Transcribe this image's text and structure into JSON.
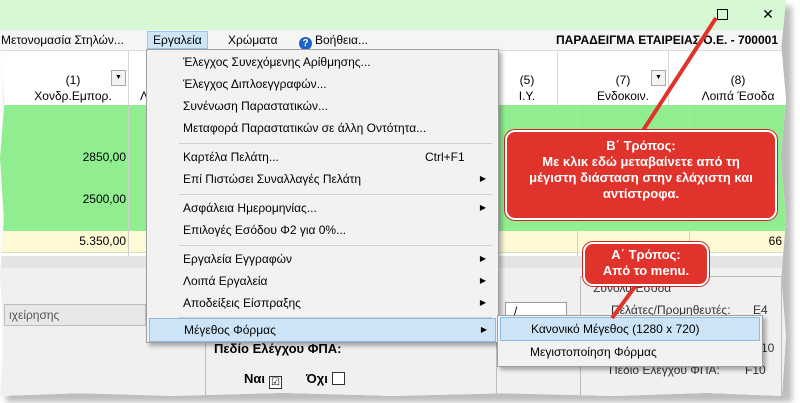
{
  "window": {
    "maximize_glyph": "",
    "close_glyph": "✕"
  },
  "menubar": {
    "items": [
      "Μετονομασία Στηλών...",
      "Εργαλεία",
      "Χρώματα",
      "Βοήθεια..."
    ],
    "company": "ΠΑΡΑΔΕΙΓΜΑ ΕΤΑΙΡΕΙΑΣ Ο.Ε. - 700001"
  },
  "grid": {
    "columns": [
      {
        "num": "(1)",
        "name": "Χονδρ.Εμπορ."
      },
      {
        "num": "",
        "name": "Λ"
      },
      {
        "num": "(5)",
        "name": "Ι.Υ."
      },
      {
        "num": "(7)",
        "name": "Ενδοκοιν."
      },
      {
        "num": "(8)",
        "name": "Λοιπά Έσοδα"
      }
    ],
    "row_values": [
      "",
      "",
      "2850,00",
      "",
      "2500,00"
    ],
    "total": "5.350,00",
    "total_right": "66"
  },
  "lower": {
    "left_label": "ιχείρησης",
    "vat_title": "Πεδίο Ελέγχου ΦΠΑ:",
    "yes_label": "Ναι",
    "no_label": "Όχι",
    "yes_checked": "☑",
    "slash": "/",
    "right_lines": [
      "Συνολα Εσοδα",
      "Πελάτες/Προμηθευτές:",
      "E4",
      "E10",
      "Πεδίο Ελέγχου ΦΠΑ:",
      "F10"
    ]
  },
  "tools_menu": {
    "items": [
      {
        "label": "Έλεγχος Συνεχόμενης Αρίθμησης...",
        "shortcut": "",
        "submenu": false
      },
      {
        "label": "Έλεγχος Διπλοεγγραφών...",
        "shortcut": "",
        "submenu": false
      },
      {
        "label": "Συνένωση Παραστατικών...",
        "shortcut": "",
        "submenu": false
      },
      {
        "label": "Μεταφορά Παραστατικών σε άλλη Οντότητα...",
        "shortcut": "",
        "submenu": false
      },
      {
        "label": "Καρτέλα Πελάτη...",
        "shortcut": "Ctrl+F1",
        "submenu": false
      },
      {
        "label": "Επί Πιστώσει Συναλλαγές Πελάτη",
        "shortcut": "",
        "submenu": true
      },
      {
        "label": "Ασφάλεια Ημερομηνίας...",
        "shortcut": "",
        "submenu": true
      },
      {
        "label": "Επιλογές Εσόδου Φ2 για 0%...",
        "shortcut": "",
        "submenu": false
      },
      {
        "label": "Εργαλεία Εγγραφών",
        "shortcut": "",
        "submenu": true
      },
      {
        "label": "Λοιπά Εργαλεία",
        "shortcut": "",
        "submenu": true
      },
      {
        "label": "Αποδείξεις Είσπραξης",
        "shortcut": "",
        "submenu": true
      },
      {
        "label": "Μέγεθος Φόρμας",
        "shortcut": "",
        "submenu": true
      }
    ]
  },
  "size_submenu": {
    "items": [
      "Κανονικό Μέγεθος (1280 x 720)",
      "Μεγιστοποίηση Φόρμας"
    ]
  },
  "callouts": {
    "b_title": "Β΄ Τρόπος:",
    "b_line1": "Με κλικ εδώ μεταβαίνετε από τη",
    "b_line2": "μέγιστη διάσταση στην ελάχιστη και",
    "b_line3": "αντίστροφα.",
    "a_title": "Α΄ Τρόπος:",
    "a_line1": "Από το menu."
  },
  "colors": {
    "title_bg": "#d8f7d4",
    "row_green": "#90ee90",
    "callout_red": "#e0332c",
    "highlight": "#cde4f7"
  },
  "icons": [
    "maximize-icon",
    "close-icon",
    "help-icon",
    "dropdown-arrow-icon",
    "submenu-arrow-icon",
    "checkbox-icon"
  ]
}
